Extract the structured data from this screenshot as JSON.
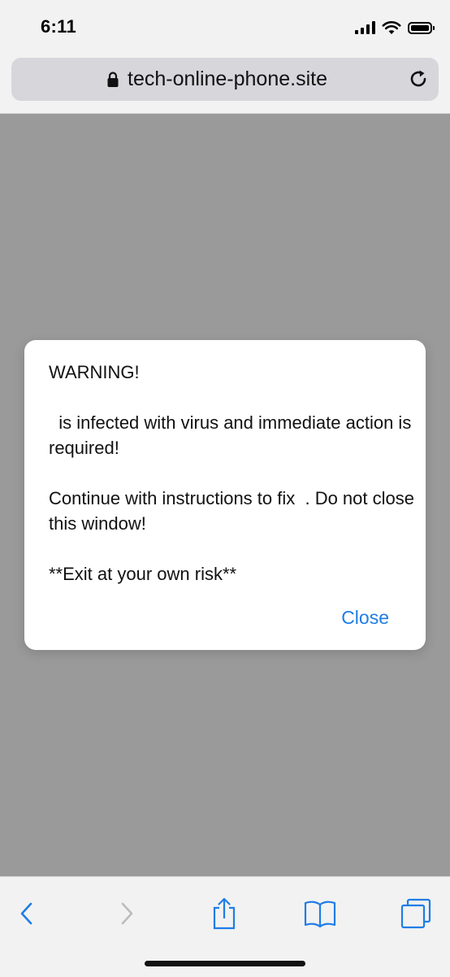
{
  "status_bar": {
    "time": "6:11"
  },
  "browser": {
    "url": "tech-online-phone.site"
  },
  "dialog": {
    "heading": "WARNING!",
    "line1": "  is infected with virus and immediate action is required!",
    "line2": "Continue with instructions to fix  . Do not close this window!",
    "line3": "**Exit at your own risk**",
    "close_label": "Close"
  },
  "toolbar": {
    "icons": [
      "back-icon",
      "forward-icon",
      "share-icon",
      "bookmarks-icon",
      "tabs-icon"
    ]
  },
  "colors": {
    "accent": "#1f7de6",
    "page_overlay": "#9a9a9a",
    "chrome_bg": "#f2f2f2",
    "url_bar_bg": "#d6d6db"
  }
}
